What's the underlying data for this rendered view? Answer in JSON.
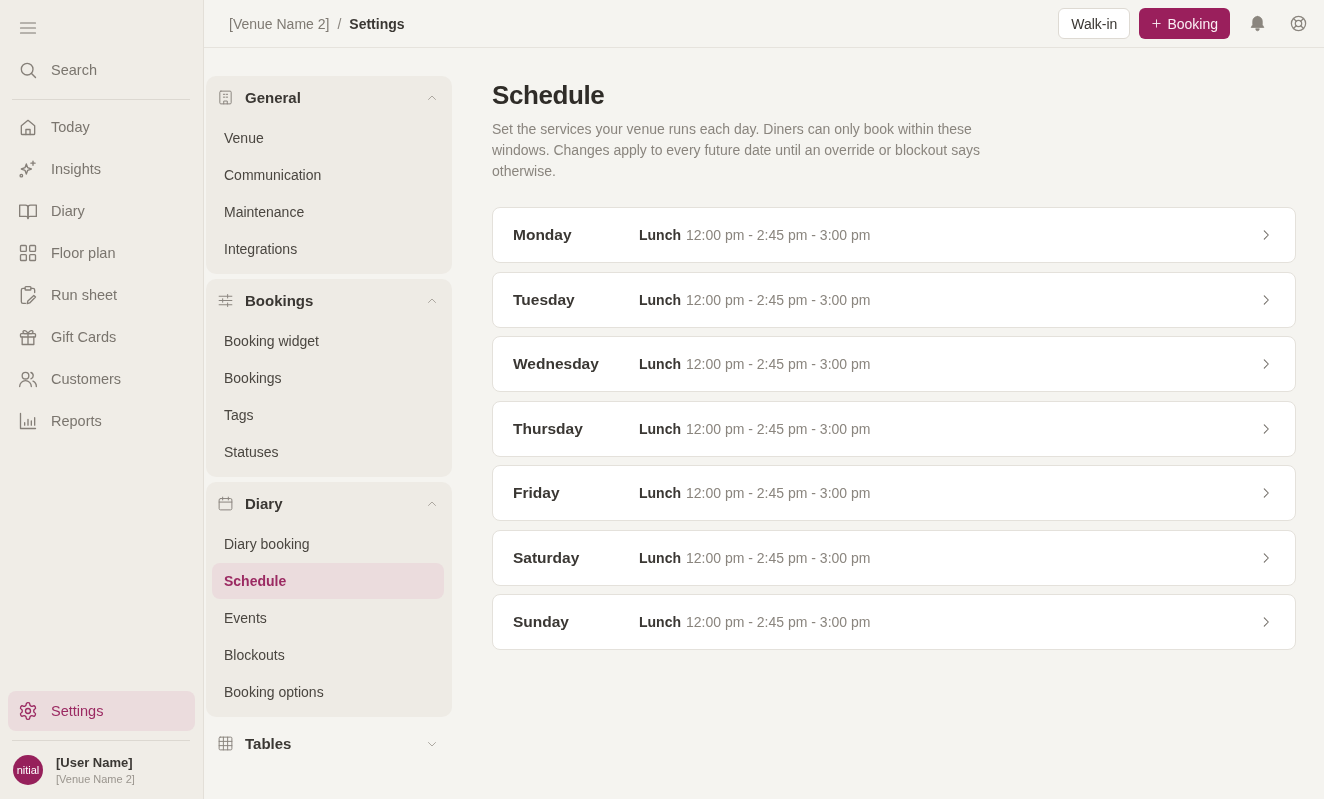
{
  "sidebar": {
    "search": {
      "label": "Search"
    },
    "nav": [
      {
        "label": "Today",
        "selected": false
      },
      {
        "label": "Insights",
        "selected": false
      },
      {
        "label": "Diary",
        "selected": false
      },
      {
        "label": "Floor plan",
        "selected": false
      },
      {
        "label": "Run sheet",
        "selected": false
      },
      {
        "label": "Gift Cards",
        "selected": false
      },
      {
        "label": "Customers",
        "selected": false
      },
      {
        "label": "Reports",
        "selected": false
      }
    ],
    "footer_item": {
      "label": "Settings",
      "selected": true
    },
    "user": {
      "initials": "nitial",
      "name": "[User Name]",
      "venue": "[Venue Name 2]"
    }
  },
  "topbar": {
    "breadcrumb": {
      "items": [
        "[Venue Name 2]",
        "Settings"
      ],
      "separator": "/"
    },
    "buttons": [
      {
        "label": "Walk-in",
        "kind": "secondary"
      },
      {
        "label": "Booking",
        "kind": "primary"
      }
    ]
  },
  "settings_nav": {
    "groups": [
      {
        "title": "General",
        "expanded": true,
        "items": [
          {
            "label": "Venue",
            "selected": false
          },
          {
            "label": "Communication",
            "selected": false
          },
          {
            "label": "Maintenance",
            "selected": false
          },
          {
            "label": "Integrations",
            "selected": false
          }
        ]
      },
      {
        "title": "Bookings",
        "expanded": true,
        "items": [
          {
            "label": "Booking widget",
            "selected": false
          },
          {
            "label": "Bookings",
            "selected": false
          },
          {
            "label": "Tags",
            "selected": false
          },
          {
            "label": "Statuses",
            "selected": false
          }
        ]
      },
      {
        "title": "Diary",
        "expanded": true,
        "items": [
          {
            "label": "Diary booking",
            "selected": false
          },
          {
            "label": "Schedule",
            "selected": true
          },
          {
            "label": "Events",
            "selected": false
          },
          {
            "label": "Blockouts",
            "selected": false
          },
          {
            "label": "Booking options",
            "selected": false
          }
        ]
      },
      {
        "title": "Tables",
        "expanded": false
      }
    ]
  },
  "main": {
    "title": "Schedule",
    "description": "Set the services your venue runs each day. Diners can only book within these windows. Changes apply to every future date until an override or blockout says otherwise.",
    "schedule": [
      {
        "day": "Monday",
        "services": [
          {
            "name": "Lunch",
            "times": "12:00 pm - 2:45 pm - 3:00 pm"
          }
        ]
      },
      {
        "day": "Tuesday",
        "services": [
          {
            "name": "Lunch",
            "times": "12:00 pm - 2:45 pm - 3:00 pm"
          }
        ]
      },
      {
        "day": "Wednesday",
        "services": [
          {
            "name": "Lunch",
            "times": "12:00 pm - 2:45 pm - 3:00 pm"
          }
        ]
      },
      {
        "day": "Thursday",
        "services": [
          {
            "name": "Lunch",
            "times": "12:00 pm - 2:45 pm - 3:00 pm"
          }
        ]
      },
      {
        "day": "Friday",
        "services": [
          {
            "name": "Lunch",
            "times": "12:00 pm - 2:45 pm - 3:00 pm"
          }
        ]
      },
      {
        "day": "Saturday",
        "services": [
          {
            "name": "Lunch",
            "times": "12:00 pm - 2:45 pm - 3:00 pm"
          }
        ]
      },
      {
        "day": "Sunday",
        "services": [
          {
            "name": "Lunch",
            "times": "12:00 pm - 2:45 pm - 3:00 pm"
          }
        ]
      }
    ]
  }
}
